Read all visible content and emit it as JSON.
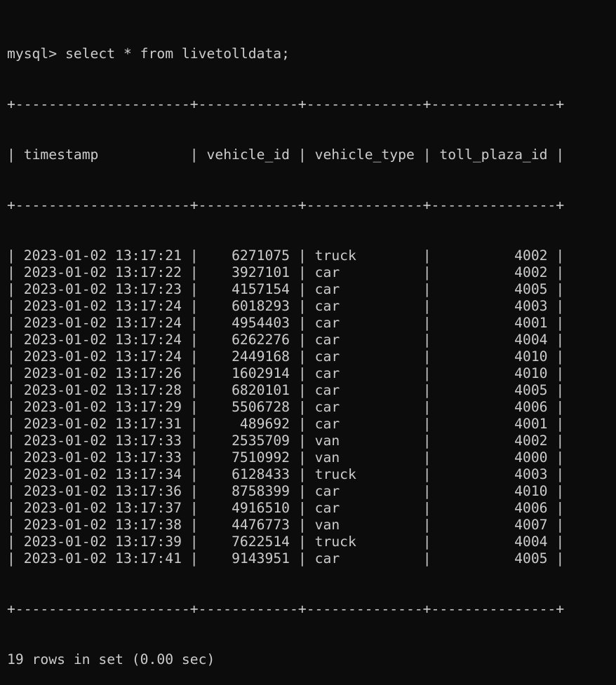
{
  "prompt": "mysql>",
  "command": "select * from livetolldata;",
  "table": {
    "columns": [
      "timestamp",
      "vehicle_id",
      "vehicle_type",
      "toll_plaza_id"
    ],
    "rows": [
      [
        "2023-01-02 13:17:21",
        "6271075",
        "truck",
        "4002"
      ],
      [
        "2023-01-02 13:17:22",
        "3927101",
        "car",
        "4002"
      ],
      [
        "2023-01-02 13:17:23",
        "4157154",
        "car",
        "4005"
      ],
      [
        "2023-01-02 13:17:24",
        "6018293",
        "car",
        "4003"
      ],
      [
        "2023-01-02 13:17:24",
        "4954403",
        "car",
        "4001"
      ],
      [
        "2023-01-02 13:17:24",
        "6262276",
        "car",
        "4004"
      ],
      [
        "2023-01-02 13:17:24",
        "2449168",
        "car",
        "4010"
      ],
      [
        "2023-01-02 13:17:26",
        "1602914",
        "car",
        "4010"
      ],
      [
        "2023-01-02 13:17:28",
        "6820101",
        "car",
        "4005"
      ],
      [
        "2023-01-02 13:17:29",
        "5506728",
        "car",
        "4006"
      ],
      [
        "2023-01-02 13:17:31",
        "489692",
        "car",
        "4001"
      ],
      [
        "2023-01-02 13:17:33",
        "2535709",
        "van",
        "4002"
      ],
      [
        "2023-01-02 13:17:33",
        "7510992",
        "van",
        "4000"
      ],
      [
        "2023-01-02 13:17:34",
        "6128433",
        "truck",
        "4003"
      ],
      [
        "2023-01-02 13:17:36",
        "8758399",
        "car",
        "4010"
      ],
      [
        "2023-01-02 13:17:37",
        "4916510",
        "car",
        "4006"
      ],
      [
        "2023-01-02 13:17:38",
        "4476773",
        "van",
        "4007"
      ],
      [
        "2023-01-02 13:17:39",
        "7622514",
        "truck",
        "4004"
      ],
      [
        "2023-01-02 13:17:41",
        "9143951",
        "car",
        "4005"
      ]
    ]
  },
  "result_summary": "19 rows in set (0.00 sec)",
  "colors": {
    "background": "#0c0c0c",
    "text": "#cccccc"
  }
}
